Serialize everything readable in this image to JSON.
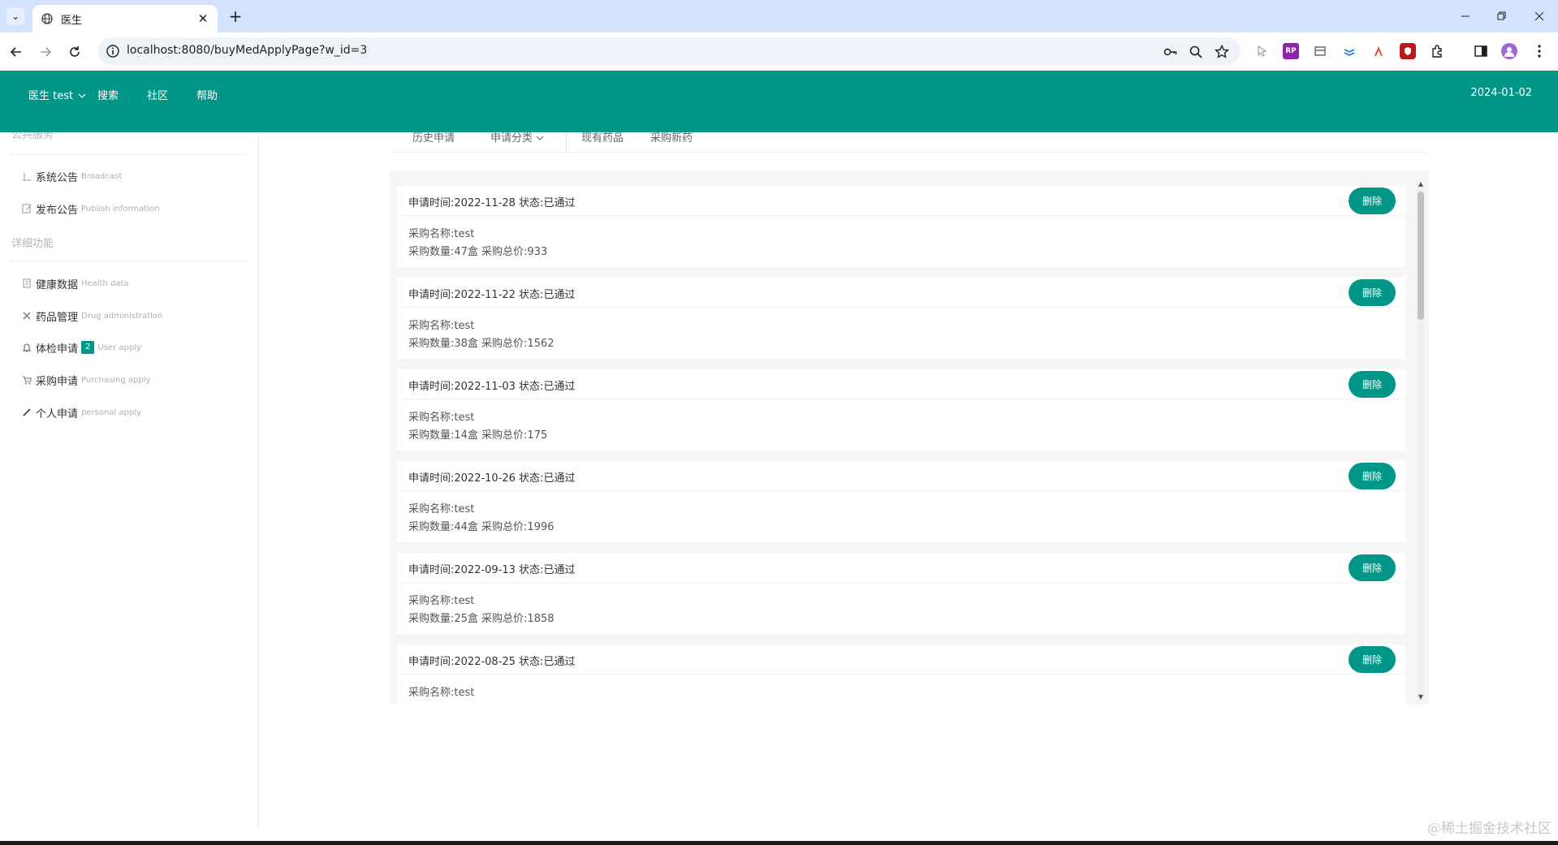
{
  "browser": {
    "tab_title": "医生",
    "url": "localhost:8080/buyMedApplyPage?w_id=3",
    "new_tab": "+",
    "close_tab": "✕"
  },
  "header": {
    "user_menu": "医生 test",
    "nav": [
      "搜索",
      "社区",
      "帮助"
    ],
    "date": "2024-01-02"
  },
  "sidebar": {
    "section1": "公共服务",
    "section2": "详细功能",
    "items": [
      {
        "cn": "系统公告",
        "en": "Broadcast"
      },
      {
        "cn": "发布公告",
        "en": "Publish information"
      },
      {
        "cn": "健康数据",
        "en": "Health data"
      },
      {
        "cn": "药品管理",
        "en": "Drug administration"
      },
      {
        "cn": "体检申请",
        "en": "User apply",
        "badge": "2"
      },
      {
        "cn": "采购申请",
        "en": "Purchasing apply"
      },
      {
        "cn": "个人申请",
        "en": "personal apply"
      }
    ]
  },
  "subtabs": [
    "历史申请",
    "申请分类",
    "现有药品",
    "采购新药"
  ],
  "records": [
    {
      "title": "申请时间:2022-11-28 状态:已通过",
      "name": "采购名称:test",
      "detail": "采购数量:47盒 采购总价:933",
      "action": "删除"
    },
    {
      "title": "申请时间:2022-11-22 状态:已通过",
      "name": "采购名称:test",
      "detail": "采购数量:38盒 采购总价:1562",
      "action": "删除"
    },
    {
      "title": "申请时间:2022-11-03 状态:已通过",
      "name": "采购名称:test",
      "detail": "采购数量:14盒 采购总价:175",
      "action": "删除"
    },
    {
      "title": "申请时间:2022-10-26 状态:已通过",
      "name": "采购名称:test",
      "detail": "采购数量:44盒 采购总价:1996",
      "action": "删除"
    },
    {
      "title": "申请时间:2022-09-13 状态:已通过",
      "name": "采购名称:test",
      "detail": "采购数量:25盒 采购总价:1858",
      "action": "删除"
    },
    {
      "title": "申请时间:2022-08-25 状态:已通过",
      "name": "采购名称:test",
      "detail": "",
      "action": "删除"
    }
  ],
  "watermark": "@稀土掘金技术社区",
  "colors": {
    "brand": "#009688",
    "tabstrip": "#d3e3fd"
  }
}
